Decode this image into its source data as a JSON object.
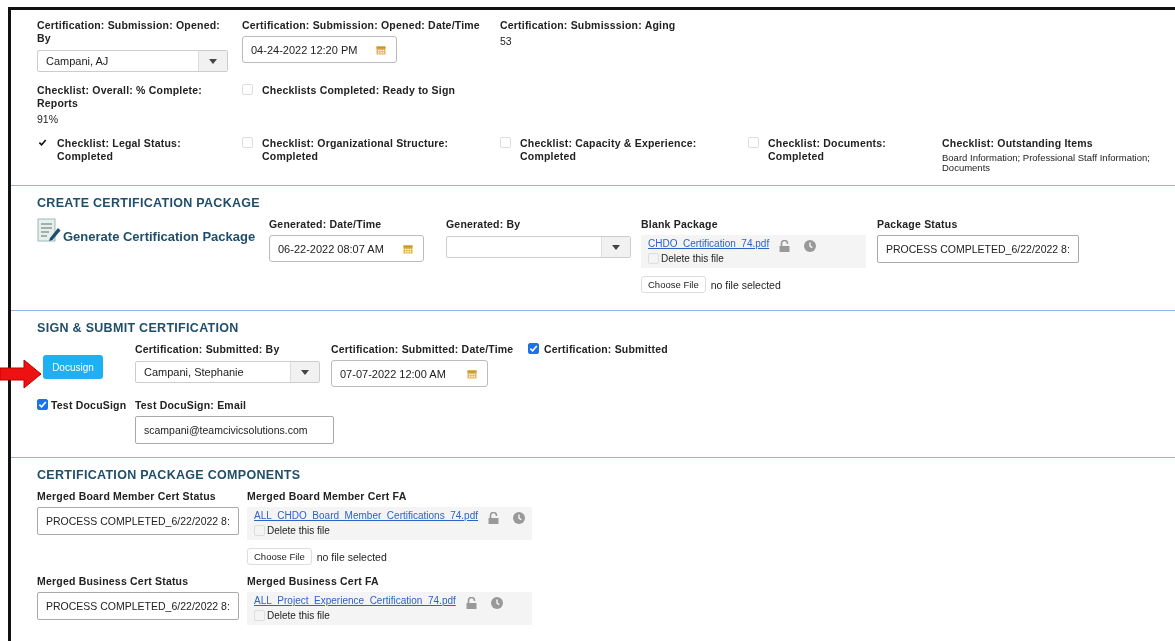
{
  "top": {
    "rows": [
      [
        {
          "kind": "select",
          "label": "Certification: Submission: Opened: By",
          "value": "Campani, AJ"
        },
        {
          "kind": "date",
          "label": "Certification: Submission: Opened: Date/Time",
          "value": "04-24-2022 12:20 PM"
        },
        {
          "kind": "text",
          "label": "Certification: Submisssion: Aging",
          "value": "53"
        }
      ],
      [
        {
          "kind": "text",
          "label": "Checklist: Overall: % Complete: Reports",
          "value": "91%"
        },
        {
          "kind": "checkbox",
          "label": "Checklists Completed: Ready to Sign",
          "checked": false
        }
      ]
    ],
    "checklists": [
      {
        "label": "Checklist: Legal Status: Completed",
        "checked": true
      },
      {
        "label": "Checklist: Organizational Structure: Completed",
        "checked": false
      },
      {
        "label": "Checklist: Capacity & Experience: Completed",
        "checked": false
      },
      {
        "label": "Checklist: Documents: Completed",
        "checked": false
      }
    ],
    "outstanding": {
      "label": "Checklist: Outstanding Items",
      "value": "Board Information; Professional Staff Information; Documents"
    }
  },
  "create": {
    "title": "CREATE CERTIFICATION PACKAGE",
    "generate_link": "Generate Certification Package",
    "generated_datetime": {
      "label": "Generated: Date/Time",
      "value": "06-22-2022 08:07 AM"
    },
    "generated_by": {
      "label": "Generated: By"
    },
    "blank_package": {
      "label": "Blank Package",
      "file_name": "CHDO_Certification_74.pdf",
      "delete_label": "Delete this file",
      "delete_checked": false,
      "choose_label": "Choose File",
      "no_file": "no file selected"
    },
    "package_status": {
      "label": "Package Status",
      "value": "PROCESS COMPLETED_6/22/2022 8:"
    }
  },
  "sign": {
    "title": "SIGN & SUBMIT CERTIFICATION",
    "docusign_button": "Docusign",
    "submitted_by": {
      "label": "Certification: Submitted: By",
      "value": "Campani, Stephanie"
    },
    "submitted_datetime": {
      "label": "Certification: Submitted: Date/Time",
      "value": "07-07-2022 12:00 AM"
    },
    "submitted": {
      "label": "Certification: Submitted",
      "checked": true
    },
    "test_docusign": {
      "label": "Test DocuSign",
      "checked": true
    },
    "test_email": {
      "label": "Test DocuSign: Email",
      "value": "scampani@teamcivicsolutions.com"
    }
  },
  "components": {
    "title": "CERTIFICATION PACKAGE COMPONENTS",
    "items": [
      {
        "status_label": "Merged Board Member Cert Status",
        "status_value": "PROCESS COMPLETED_6/22/2022 8:",
        "fa_label": "Merged Board Member Cert FA",
        "file_name": "ALL_CHDO_Board_Member_Certifications_74.pdf",
        "delete_label": "Delete this file",
        "delete_checked": false,
        "choose_label": "Choose File",
        "no_file": "no file selected"
      },
      {
        "status_label": "Merged Business Cert Status",
        "status_value": "PROCESS COMPLETED_6/22/2022 8:",
        "fa_label": "Merged Business Cert FA",
        "file_name": "ALL_Project_Experience_Certification_74.pdf",
        "delete_label": "Delete this file",
        "delete_checked": false
      }
    ]
  }
}
